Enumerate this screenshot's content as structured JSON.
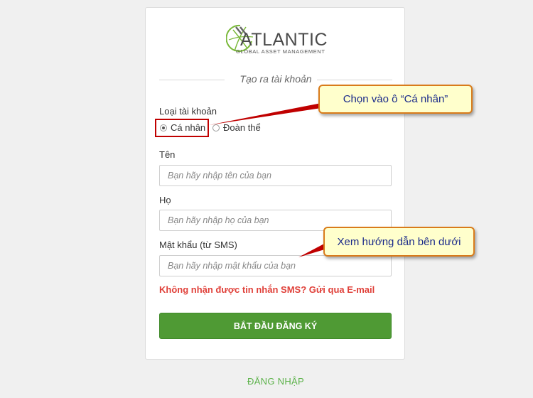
{
  "logo": {
    "brand": "ATLANTIC",
    "tagline": "GLOBAL ASSET MANAGEMENT"
  },
  "form": {
    "title": "Tạo ra tài khoản",
    "account_type": {
      "label": "Loại tài khoản",
      "options": [
        {
          "label": "Cá nhân",
          "selected": true
        },
        {
          "label": "Đoàn thể",
          "selected": false
        }
      ]
    },
    "first_name": {
      "label": "Tên",
      "placeholder": "Bạn hãy nhập tên của bạn"
    },
    "last_name": {
      "label": "Họ",
      "placeholder": "Bạn hãy nhập họ của bạn"
    },
    "password": {
      "label": "Mật khẩu (từ SMS)",
      "placeholder": "Bạn hãy nhập mật khẩu của bạn"
    },
    "sms_link": "Không nhận được tin nhắn SMS? Gửi qua E-mail",
    "submit_label": "BẮT ĐẦU ĐĂNG KÝ"
  },
  "login_link": "ĐĂNG NHẬP",
  "annotations": {
    "callout_individual": "Chọn vào ô “Cá nhân”",
    "callout_guide": "Xem hướng dẫn bên dưới"
  },
  "colors": {
    "primary_green": "#4f9a34",
    "link_red": "#e0413a",
    "login_green": "#5cb24a",
    "callout_bg": "#ffffcc",
    "callout_border": "#d97b1a",
    "highlight_red": "#c00000"
  }
}
